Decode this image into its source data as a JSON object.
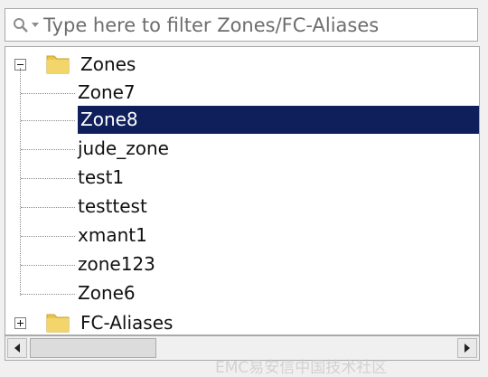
{
  "filter": {
    "placeholder": "Type here to filter Zones/FC-Aliases",
    "icon": "search-icon"
  },
  "tree": {
    "zones": {
      "label": "Zones",
      "expanded": true,
      "children": [
        "Zone7",
        "Zone8",
        "jude_zone",
        "test1",
        "testtest",
        "xmant1",
        "zone123",
        "Zone6"
      ],
      "selected": "Zone8"
    },
    "fc_aliases": {
      "label": "FC-Aliases",
      "expanded": false
    }
  },
  "colors": {
    "selection": "#0f1f5c",
    "folder": "#e8c64a"
  },
  "watermark": "EMC易安信中国技术社区"
}
